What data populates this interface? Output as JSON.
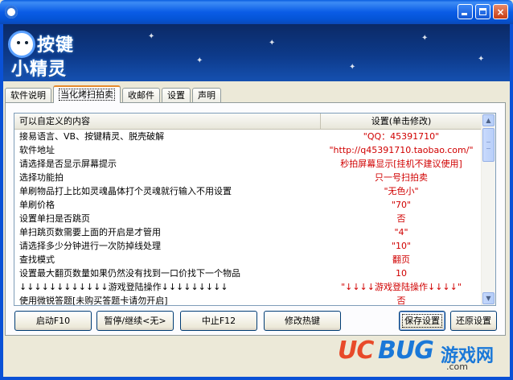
{
  "window": {
    "title": "",
    "buttons": {
      "minimize": "minimize",
      "maximize": "maximize",
      "close": "×"
    }
  },
  "banner": {
    "logo_line1": "按键",
    "logo_line2": "小精灵"
  },
  "tabs": [
    {
      "label": "软件说明",
      "active": false
    },
    {
      "label": "当化烤扫拍卖",
      "active": true
    },
    {
      "label": "收邮件",
      "active": false
    },
    {
      "label": "设置",
      "active": false
    },
    {
      "label": "声明",
      "active": false
    }
  ],
  "table": {
    "columns": [
      "可以自定义的内容",
      "设置(单击修改)"
    ],
    "rows": [
      {
        "key": "接易语言、VB、按键精灵、脱壳破解",
        "value": "\"QQ：45391710\""
      },
      {
        "key": "软件地址",
        "value": "\"http://q45391710.taobao.com/\""
      },
      {
        "key": "请选择是否显示屏幕提示",
        "value": "秒拍屏幕显示[挂机不建议使用]"
      },
      {
        "key": "选择功能拍",
        "value": "只一号扫拍卖"
      },
      {
        "key": "单刷物品打上比如灵魂晶体打个灵魂就行输入不用设置",
        "value": "\"无色小\""
      },
      {
        "key": "单刷价格",
        "value": "\"70\""
      },
      {
        "key": "设置单扫是否跳页",
        "value": "否"
      },
      {
        "key": "单扫跳页数需要上面的开启是才管用",
        "value": "\"4\""
      },
      {
        "key": "请选择多少分钟进行一次防掉线处理",
        "value": "\"10\""
      },
      {
        "key": "查找模式",
        "value": "翻页"
      },
      {
        "key": "设置最大翻页数量如果仍然没有找到一口价找下一个物品",
        "value": "10"
      },
      {
        "key": "↓↓↓↓↓↓↓↓↓↓↓↓游戏登陆操作↓↓↓↓↓↓↓↓↓",
        "value": "\"↓↓↓↓游戏登陆操作↓↓↓↓\""
      },
      {
        "key": "使用微锐答题[未购买答题卡请勿开启]",
        "value": "否"
      }
    ]
  },
  "scrollbar": {
    "up": "▲",
    "down": "▼"
  },
  "buttons": {
    "start": "启动F10",
    "pause": "暂停/继续<无>",
    "stop": "中止F12",
    "hotkey": "修改热键",
    "save": "保存设置",
    "restore": "还原设置"
  },
  "watermark": {
    "uc": "UC",
    "bug": "BUG",
    "cn": "游戏网",
    "domain": ".com"
  },
  "colors": {
    "titlebar": "#0a5ce6",
    "value_text": "#d00000",
    "banner": "#0d3a8a"
  }
}
